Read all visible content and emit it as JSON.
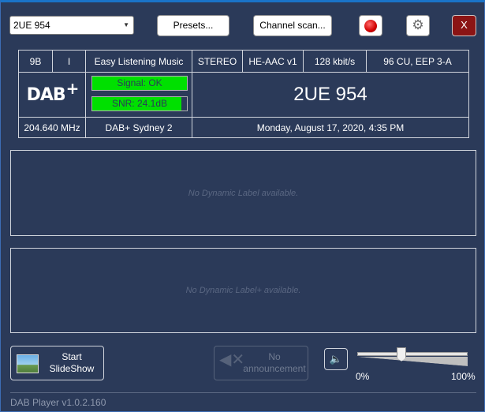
{
  "top_bar": {
    "station_select": "2UE 954",
    "presets_label": "Presets...",
    "channel_scan_label": "Channel scan...",
    "record_icon": "record-dot-icon",
    "settings_icon": "gear-icon",
    "close_label": "X"
  },
  "info": {
    "channel": "9B",
    "type": "I",
    "genre": "Easy Listening Music",
    "mode": "STEREO",
    "codec": "HE-AAC v1",
    "bitrate": "128 kbit/s",
    "protection": "96 CU, EEP 3-A",
    "logo_text": "DAB",
    "logo_plus": "+",
    "signal_label": "Signal: OK",
    "snr_label": "SNR: 24.1dB",
    "snr_fill": 0.94,
    "station_name": "2UE 954",
    "frequency": "204.640 MHz",
    "ensemble": "DAB+ Sydney 2",
    "datetime": "Monday, August 17, 2020, 4:35 PM"
  },
  "panels": {
    "dynamic_label": "No Dynamic Label available.",
    "dynamic_label_plus": "No Dynamic Label+ available."
  },
  "controls": {
    "slideshow_label_1": "Start",
    "slideshow_label_2": "SlideShow",
    "announcement_label_1": "No",
    "announcement_label_2": "announcement",
    "volume_min": "0%",
    "volume_max": "100%",
    "volume_level": 0.4
  },
  "footer": {
    "version": "DAB Player v1.0.2.160"
  },
  "colors": {
    "background": "#2b3a59",
    "meter_green": "#00e000",
    "close_red": "#8b1414"
  }
}
